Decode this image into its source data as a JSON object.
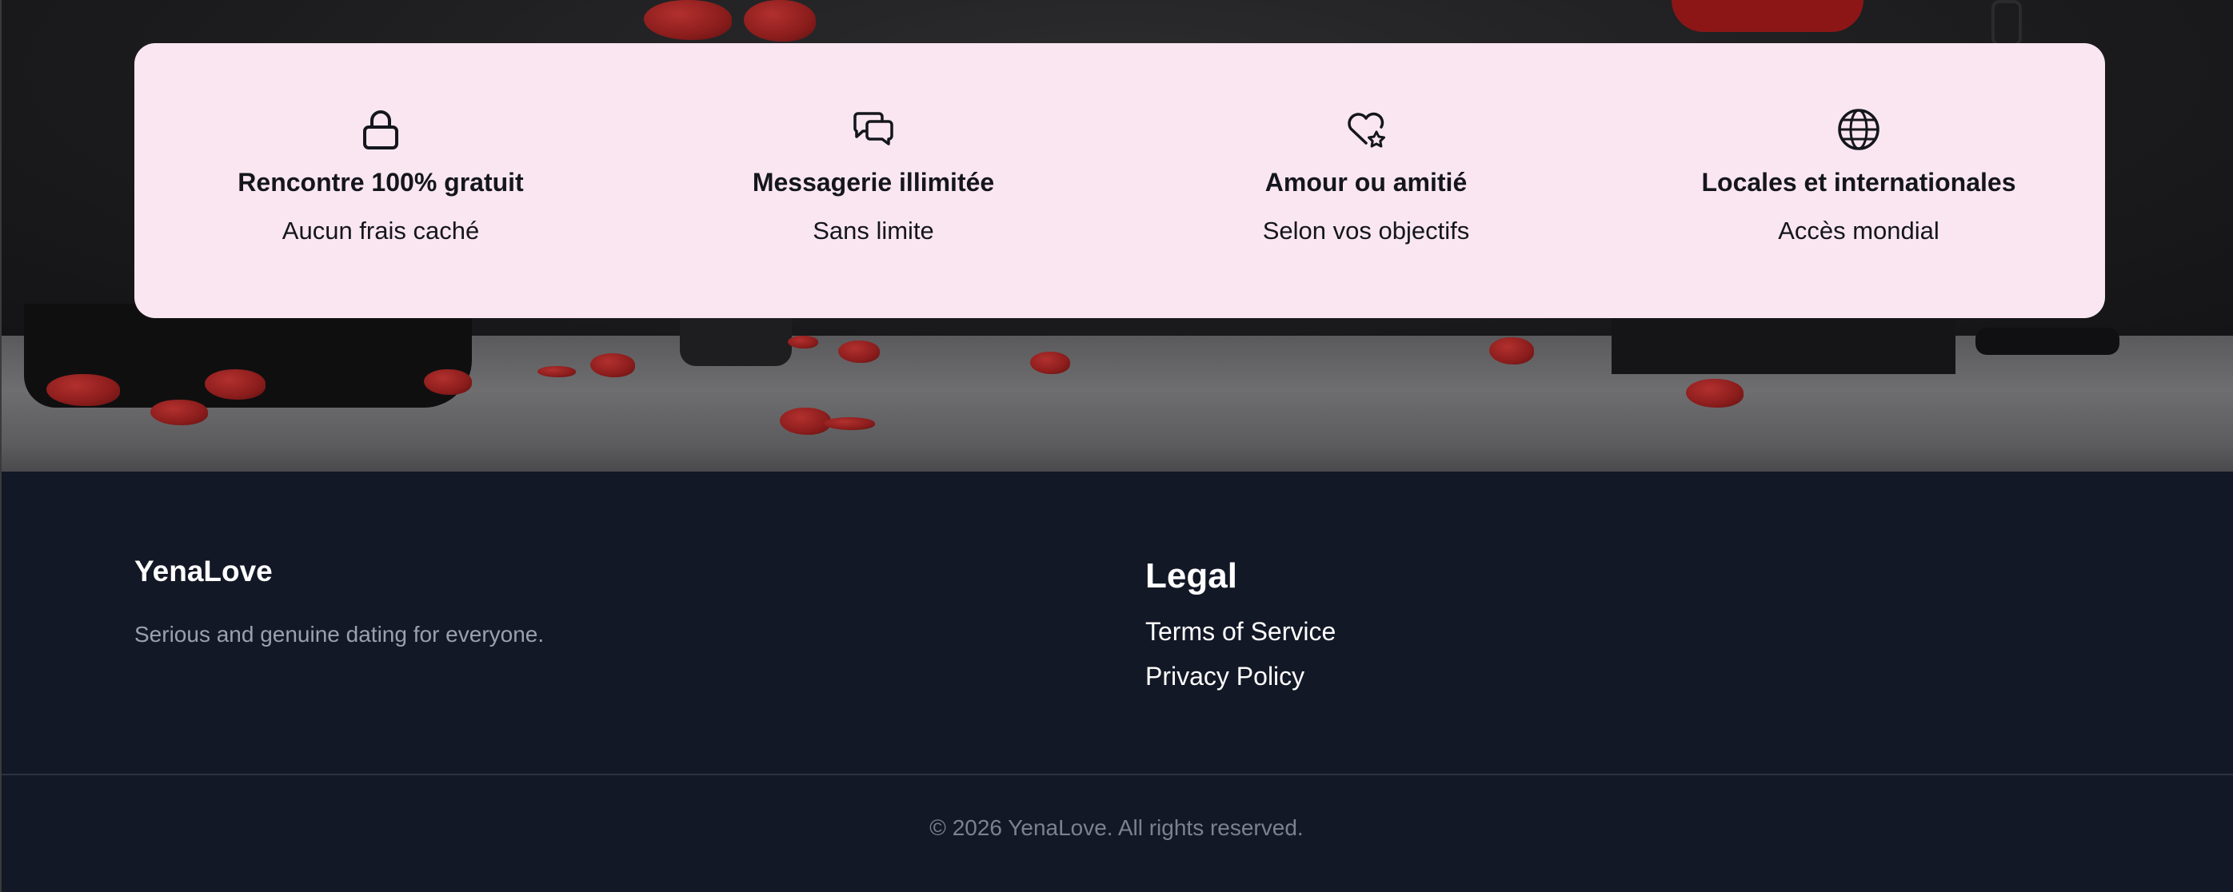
{
  "features": [
    {
      "icon": "lock-icon",
      "title": "Rencontre 100% gratuit",
      "description": "Aucun frais caché"
    },
    {
      "icon": "chat-bubbles-icon",
      "title": "Messagerie illimitée",
      "description": "Sans limite"
    },
    {
      "icon": "heart-star-icon",
      "title": "Amour ou amitié",
      "description": "Selon vos objectifs"
    },
    {
      "icon": "globe-icon",
      "title": "Locales et internationales",
      "description": "Accès mondial"
    }
  ],
  "footer": {
    "brand": "YenaLove",
    "tagline": "Serious and genuine dating for everyone.",
    "legal": {
      "title": "Legal",
      "links": [
        "Terms of Service",
        "Privacy Policy"
      ]
    },
    "copyright": "© 2026 YenaLove. All rights reserved."
  },
  "colors": {
    "card_background": "#f9e6f1",
    "footer_background": "#131826",
    "petal": "#8b1d1c"
  }
}
